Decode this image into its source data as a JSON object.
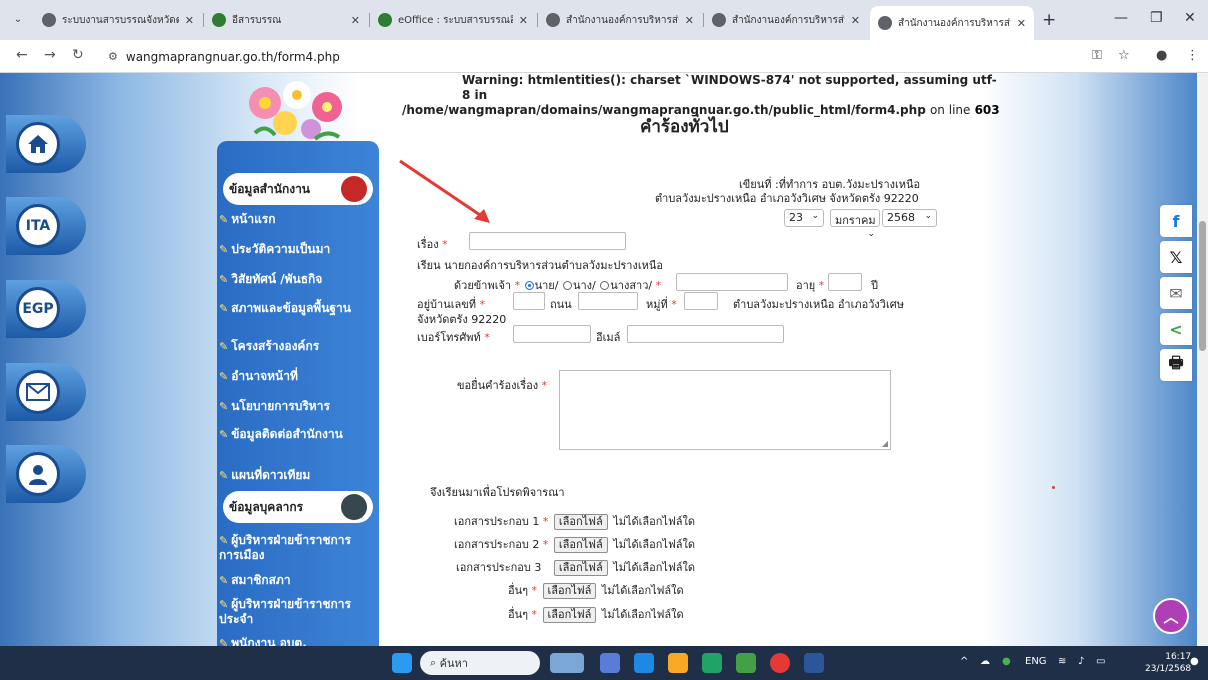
{
  "browser": {
    "tabs": [
      {
        "label": "ระบบงานสารบรรณจังหวัดตรัง",
        "active": false
      },
      {
        "label": "อีสารบรรณ",
        "active": false
      },
      {
        "label": "eOffice : ระบบสารบรรณอิเล็กท",
        "active": false
      },
      {
        "label": "สำนักงานองค์การบริหารส่วนตำ",
        "active": false
      },
      {
        "label": "สำนักงานองค์การบริหารส่วนตำ",
        "active": false
      },
      {
        "label": "สำนักงานองค์การบริหารส่วนตำ",
        "active": true
      }
    ],
    "url": "wangmaprangnuar.go.th/form4.php"
  },
  "warning": {
    "label": "Warning",
    "message": ": htmlentities(): charset `WINDOWS-874' not supported, assuming utf-8 in",
    "path": "/home/wangmapran/domains/wangmaprangnuar.go.th/public_html/form4.php",
    "on_line": "on line",
    "line": "603"
  },
  "sidebar": {
    "sections": [
      {
        "title": "ข้อมูลสำนักงาน"
      },
      {
        "title": "ข้อมูลบุคลากร"
      }
    ],
    "items": [
      "หน้าแรก",
      "ประวัติความเป็นมา",
      "วิสัยทัศน์ /พันธกิจ",
      "สภาพและข้อมูลพื้นฐาน",
      "โครงสร้างองค์กร",
      "อำนาจหน้าที่",
      "นโยบายการบริหาร",
      "ข้อมูลติดต่อสำนักงาน",
      "แผนที่ดาวเทียม",
      "ผู้บริหารฝ่ายข้าราชการการเมือง",
      "สมาชิกสภา",
      "ผู้บริหารฝ่ายข้าราชการประจำ",
      "พนักงาน อบต."
    ],
    "left_icons": [
      "home-icon",
      "itax-icon",
      "egp-icon",
      "mail-icon",
      "user-icon"
    ],
    "left_icon_labels": {
      "itax": "ITA",
      "egp": "EGP"
    }
  },
  "form": {
    "title": "คำร้องทั่วไป",
    "written_at_1": "เขียนที่ :ที่ทำการ อบต.วังมะปรางเหนือ",
    "written_at_2": "ตำบลวังมะปรางเหนือ อำเภอวังวิเศษ จังหวัดตรัง 92220",
    "date_day": "23",
    "date_month": "มกราคม",
    "date_year": "2568",
    "subject_label": "เรื่อง",
    "to_label": "เรียน นายกองค์การบริหารส่วนตำบลวังมะปรางเหนือ",
    "i_label": "ด้วยข้าพเจ้า",
    "prefix_mr": "นาย/",
    "prefix_mrs": "นาง/",
    "prefix_miss": "นางสาว/",
    "age_label": "อายุ",
    "years_label": "ปี",
    "house_no_label": "อยู่บ้านเลขที่",
    "road_label": "ถนน",
    "moo_label": "หมู่ที่",
    "addr_fixed_1": "ตำบลวังมะปรางเหนือ อำเภอวังวิเศษ",
    "addr_fixed_2": "จังหวัดตรัง 92220",
    "phone_label": "เบอร์โทรศัพท์",
    "email_label": "อีเมล์",
    "request_label": "ขอยื่นคำร้องเรื่อง",
    "closing": "จึงเรียนมาเพื่อโปรดพิจารณา",
    "file_button": "เลือกไฟล์",
    "no_file": "ไม่ได้เลือกไฟล์ใด",
    "attachments": [
      {
        "label": "เอกสารประกอบ 1",
        "required": true
      },
      {
        "label": "เอกสารประกอบ 2",
        "required": true
      },
      {
        "label": "เอกสารประกอบ 3",
        "required": false
      },
      {
        "label": "อื่นๆ",
        "required": true
      },
      {
        "label": "อื่นๆ",
        "required": true
      }
    ]
  },
  "share": {
    "facebook": "f",
    "x": "𝕏",
    "email": "✉",
    "share": "<",
    "print": "🖶"
  },
  "taskbar": {
    "search_placeholder": "ค้นหา",
    "lang": "ENG",
    "time": "16:17",
    "date": "23/1/2568"
  }
}
